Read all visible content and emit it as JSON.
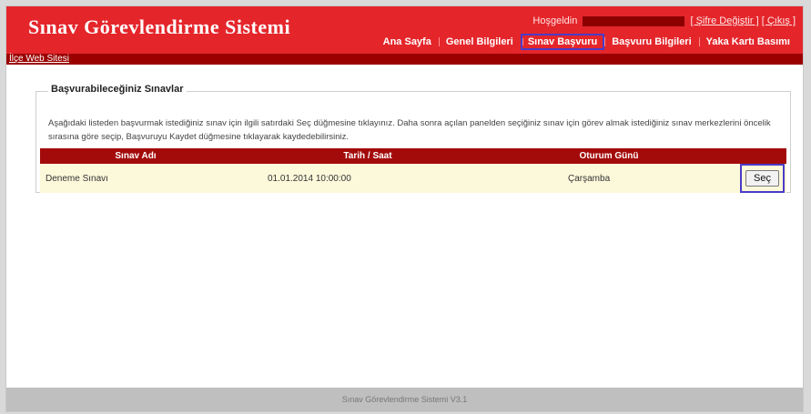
{
  "header": {
    "title": "Sınav Görevlendirme Sistemi",
    "welcome": "Hoşgeldin",
    "change_password": "[ Şifre Değiştir ]",
    "logout": "[ Çıkış ]"
  },
  "nav": {
    "items": [
      "Ana Sayfa",
      "Genel Bilgileri",
      "Sınav Başvuru",
      "Başvuru Bilgileri",
      "Yaka Kartı Basımı"
    ],
    "active_index": 2
  },
  "subbar": {
    "link": "İlçe Web Sitesi"
  },
  "panel": {
    "legend": "Başvurabileceğiniz Sınavlar",
    "description": "Aşağıdaki listeden başvurmak istediğiniz sınav için ilgili satırdaki Seç düğmesine tıklayınız. Daha sonra açılan panelden seçiğiniz sınav için görev almak istediğiniz sınav merkezlerini öncelik sırasına göre seçip, Başvuruyu Kaydet düğmesine tıklayarak kaydedebilirsiniz."
  },
  "table": {
    "headers": [
      "Sınav Adı",
      "Tarih / Saat",
      "Oturum Günü"
    ],
    "rows": [
      {
        "name": "Deneme Sınavı",
        "datetime": "01.01.2014 10:00:00",
        "day": "Çarşamba",
        "action": "Seç"
      }
    ]
  },
  "footer": {
    "text": "Sınav Görevlendirme Sistemi V3.1"
  },
  "colors": {
    "header": "#e4262b",
    "subbar": "#9a0000",
    "table_header": "#a30b0b",
    "row": "#fcf8da",
    "highlight": "#4a3cc8"
  }
}
